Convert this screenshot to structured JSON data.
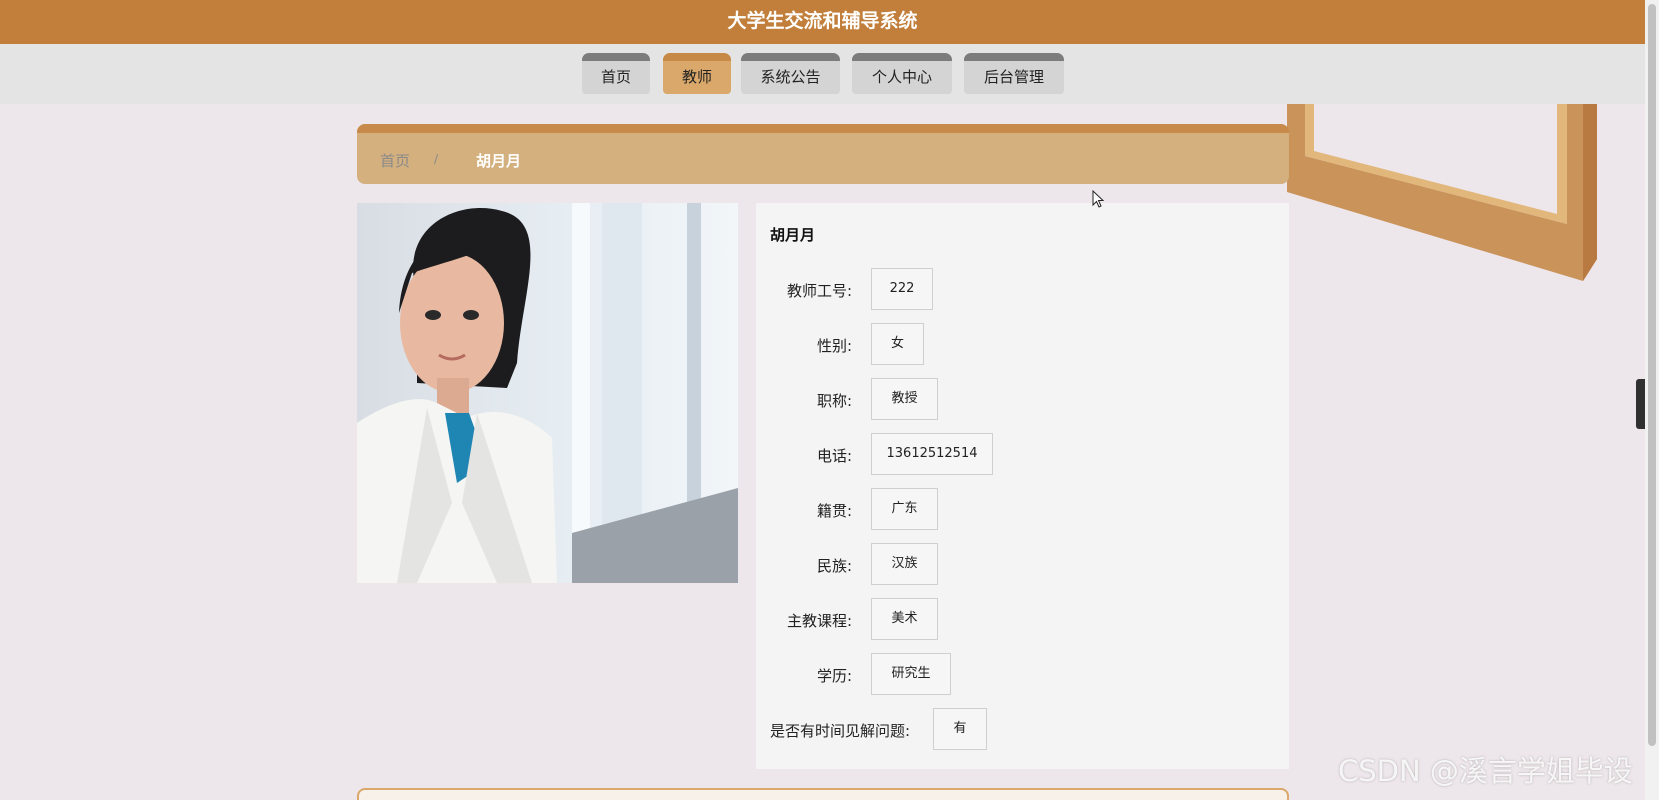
{
  "app": {
    "title": "大学生交流和辅导系统"
  },
  "nav": {
    "items": [
      {
        "label": "首页"
      },
      {
        "label": "教师"
      },
      {
        "label": "系统公告"
      },
      {
        "label": "个人中心"
      },
      {
        "label": "后台管理"
      }
    ],
    "active": "教师"
  },
  "breadcrumb": {
    "home": "首页",
    "separator": "/",
    "current": "胡月月"
  },
  "teacher": {
    "name": "胡月月",
    "fields": [
      {
        "label": "教师工号:",
        "value": "222"
      },
      {
        "label": "性别:",
        "value": "女"
      },
      {
        "label": "职称:",
        "value": "教授"
      },
      {
        "label": "电话:",
        "value": "13612512514"
      },
      {
        "label": "籍贯:",
        "value": "广东"
      },
      {
        "label": "民族:",
        "value": "汉族"
      },
      {
        "label": "主教课程:",
        "value": "美术"
      },
      {
        "label": "学历:",
        "value": "研究生"
      },
      {
        "label": "是否有时间见解问题:",
        "value": "有"
      }
    ]
  },
  "side_handle": {
    "icon": "chevron-right-icon",
    "glyph": "›"
  },
  "watermark": "CSDN @溪言学姐毕设",
  "colors": {
    "brand": "#c17f3b",
    "accent": "#d9a86a",
    "breadcrumb": "#d4b07e"
  }
}
